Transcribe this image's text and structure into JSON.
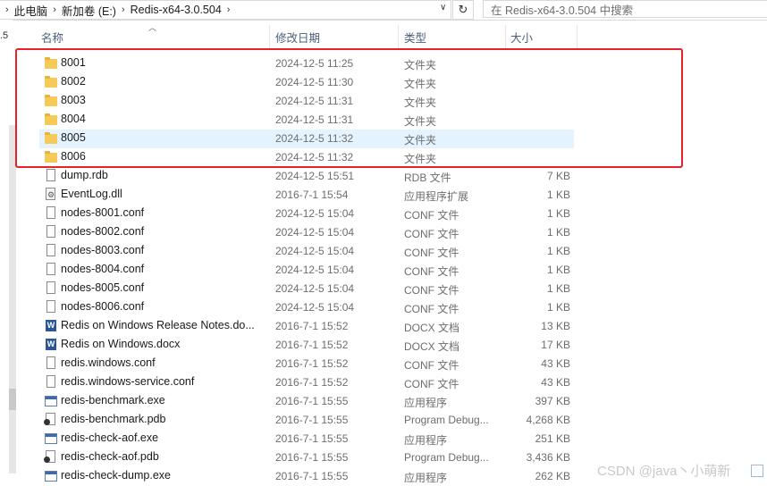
{
  "address": {
    "crumbs": [
      "此电脑",
      "新加卷 (E:)",
      "Redis-x64-3.0.504"
    ],
    "search_placeholder": "在 Redis-x64-3.0.504 中搜索"
  },
  "nav": {
    "partial_label": ".5"
  },
  "columns": {
    "name": "名称",
    "date": "修改日期",
    "type": "类型",
    "size": "大小"
  },
  "rows": [
    {
      "name": "8001",
      "date": "2024-12-5 11:25",
      "type": "文件夹",
      "size": "",
      "icon": "folder-icon"
    },
    {
      "name": "8002",
      "date": "2024-12-5 11:30",
      "type": "文件夹",
      "size": "",
      "icon": "folder-icon"
    },
    {
      "name": "8003",
      "date": "2024-12-5 11:31",
      "type": "文件夹",
      "size": "",
      "icon": "folder-icon"
    },
    {
      "name": "8004",
      "date": "2024-12-5 11:31",
      "type": "文件夹",
      "size": "",
      "icon": "folder-icon"
    },
    {
      "name": "8005",
      "date": "2024-12-5 11:32",
      "type": "文件夹",
      "size": "",
      "icon": "folder-icon",
      "selected": true
    },
    {
      "name": "8006",
      "date": "2024-12-5 11:32",
      "type": "文件夹",
      "size": "",
      "icon": "folder-icon"
    },
    {
      "name": "dump.rdb",
      "date": "2024-12-5 15:51",
      "type": "RDB 文件",
      "size": "7 KB",
      "icon": "file-icon"
    },
    {
      "name": "EventLog.dll",
      "date": "2016-7-1 15:54",
      "type": "应用程序扩展",
      "size": "1 KB",
      "icon": "dll-icon"
    },
    {
      "name": "nodes-8001.conf",
      "date": "2024-12-5 15:04",
      "type": "CONF 文件",
      "size": "1 KB",
      "icon": "file-icon"
    },
    {
      "name": "nodes-8002.conf",
      "date": "2024-12-5 15:04",
      "type": "CONF 文件",
      "size": "1 KB",
      "icon": "file-icon"
    },
    {
      "name": "nodes-8003.conf",
      "date": "2024-12-5 15:04",
      "type": "CONF 文件",
      "size": "1 KB",
      "icon": "file-icon"
    },
    {
      "name": "nodes-8004.conf",
      "date": "2024-12-5 15:04",
      "type": "CONF 文件",
      "size": "1 KB",
      "icon": "file-icon"
    },
    {
      "name": "nodes-8005.conf",
      "date": "2024-12-5 15:04",
      "type": "CONF 文件",
      "size": "1 KB",
      "icon": "file-icon"
    },
    {
      "name": "nodes-8006.conf",
      "date": "2024-12-5 15:04",
      "type": "CONF 文件",
      "size": "1 KB",
      "icon": "file-icon"
    },
    {
      "name": "Redis on Windows Release Notes.do...",
      "date": "2016-7-1 15:52",
      "type": "DOCX 文档",
      "size": "13 KB",
      "icon": "word-icon"
    },
    {
      "name": "Redis on Windows.docx",
      "date": "2016-7-1 15:52",
      "type": "DOCX 文档",
      "size": "17 KB",
      "icon": "word-icon"
    },
    {
      "name": "redis.windows.conf",
      "date": "2016-7-1 15:52",
      "type": "CONF 文件",
      "size": "43 KB",
      "icon": "file-icon"
    },
    {
      "name": "redis.windows-service.conf",
      "date": "2016-7-1 15:52",
      "type": "CONF 文件",
      "size": "43 KB",
      "icon": "file-icon"
    },
    {
      "name": "redis-benchmark.exe",
      "date": "2016-7-1 15:55",
      "type": "应用程序",
      "size": "397 KB",
      "icon": "exe-icon"
    },
    {
      "name": "redis-benchmark.pdb",
      "date": "2016-7-1 15:55",
      "type": "Program Debug...",
      "size": "4,268 KB",
      "icon": "pdb-icon"
    },
    {
      "name": "redis-check-aof.exe",
      "date": "2016-7-1 15:55",
      "type": "应用程序",
      "size": "251 KB",
      "icon": "exe-icon"
    },
    {
      "name": "redis-check-aof.pdb",
      "date": "2016-7-1 15:55",
      "type": "Program Debug...",
      "size": "3,436 KB",
      "icon": "pdb-icon"
    },
    {
      "name": "redis-check-dump.exe",
      "date": "2016-7-1 15:55",
      "type": "应用程序",
      "size": "262 KB",
      "icon": "exe-icon"
    }
  ],
  "watermark": "CSDN @java丶小萌新",
  "colors": {
    "selection": "#e5f3ff",
    "annotation": "#e8222b",
    "folder": "#f5ca58"
  }
}
